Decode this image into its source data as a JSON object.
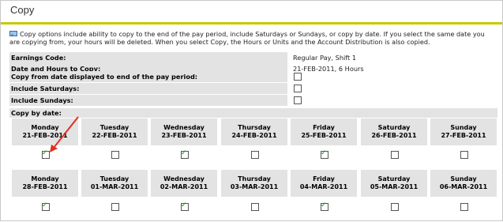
{
  "page": {
    "title": "Copy",
    "info_text": "Copy options include ability to copy to the end of the pay period, include Saturdays or Sundays, or copy by date. If you select the same date you are copying from, your hours will be deleted. When you select Copy, the Hours or Units and the Account Distribution is also copied."
  },
  "form": {
    "earnings_code": {
      "label": "Earnings Code:",
      "value": "Regular Pay, Shift 1"
    },
    "date_hours": {
      "label": "Date and Hours to Copy:",
      "value": "21-FEB-2011, 6 Hours"
    },
    "copy_end": {
      "label": "Copy from date displayed to end of the pay period:",
      "checked": false
    },
    "saturdays": {
      "label": "Include Saturdays:",
      "checked": false
    },
    "sundays": {
      "label": "Include Sundays:",
      "checked": false
    },
    "by_date_label": "Copy by date:"
  },
  "weeks": [
    [
      {
        "day": "Monday",
        "date": "21-FEB-2011",
        "checked": true
      },
      {
        "day": "Tuesday",
        "date": "22-FEB-2011",
        "checked": false
      },
      {
        "day": "Wednesday",
        "date": "23-FEB-2011",
        "checked": true
      },
      {
        "day": "Thursday",
        "date": "24-FEB-2011",
        "checked": false
      },
      {
        "day": "Friday",
        "date": "25-FEB-2011",
        "checked": true
      },
      {
        "day": "Saturday",
        "date": "26-FEB-2011",
        "checked": false
      },
      {
        "day": "Sunday",
        "date": "27-FEB-2011",
        "checked": false
      }
    ],
    [
      {
        "day": "Monday",
        "date": "28-FEB-2011",
        "checked": true
      },
      {
        "day": "Tuesday",
        "date": "01-MAR-2011",
        "checked": false
      },
      {
        "day": "Wednesday",
        "date": "02-MAR-2011",
        "checked": true
      },
      {
        "day": "Thursday",
        "date": "03-MAR-2011",
        "checked": false
      },
      {
        "day": "Friday",
        "date": "04-MAR-2011",
        "checked": true
      },
      {
        "day": "Saturday",
        "date": "05-MAR-2011",
        "checked": false
      },
      {
        "day": "Sunday",
        "date": "06-MAR-2011",
        "checked": false
      }
    ]
  ],
  "colors": {
    "title_rule": "#c8c800",
    "label_bg": "#e3e3e3",
    "check": "#1a8a1a",
    "arrow": "#e03020"
  },
  "icons": {
    "info": "note-icon",
    "annotation": "red-arrow"
  }
}
